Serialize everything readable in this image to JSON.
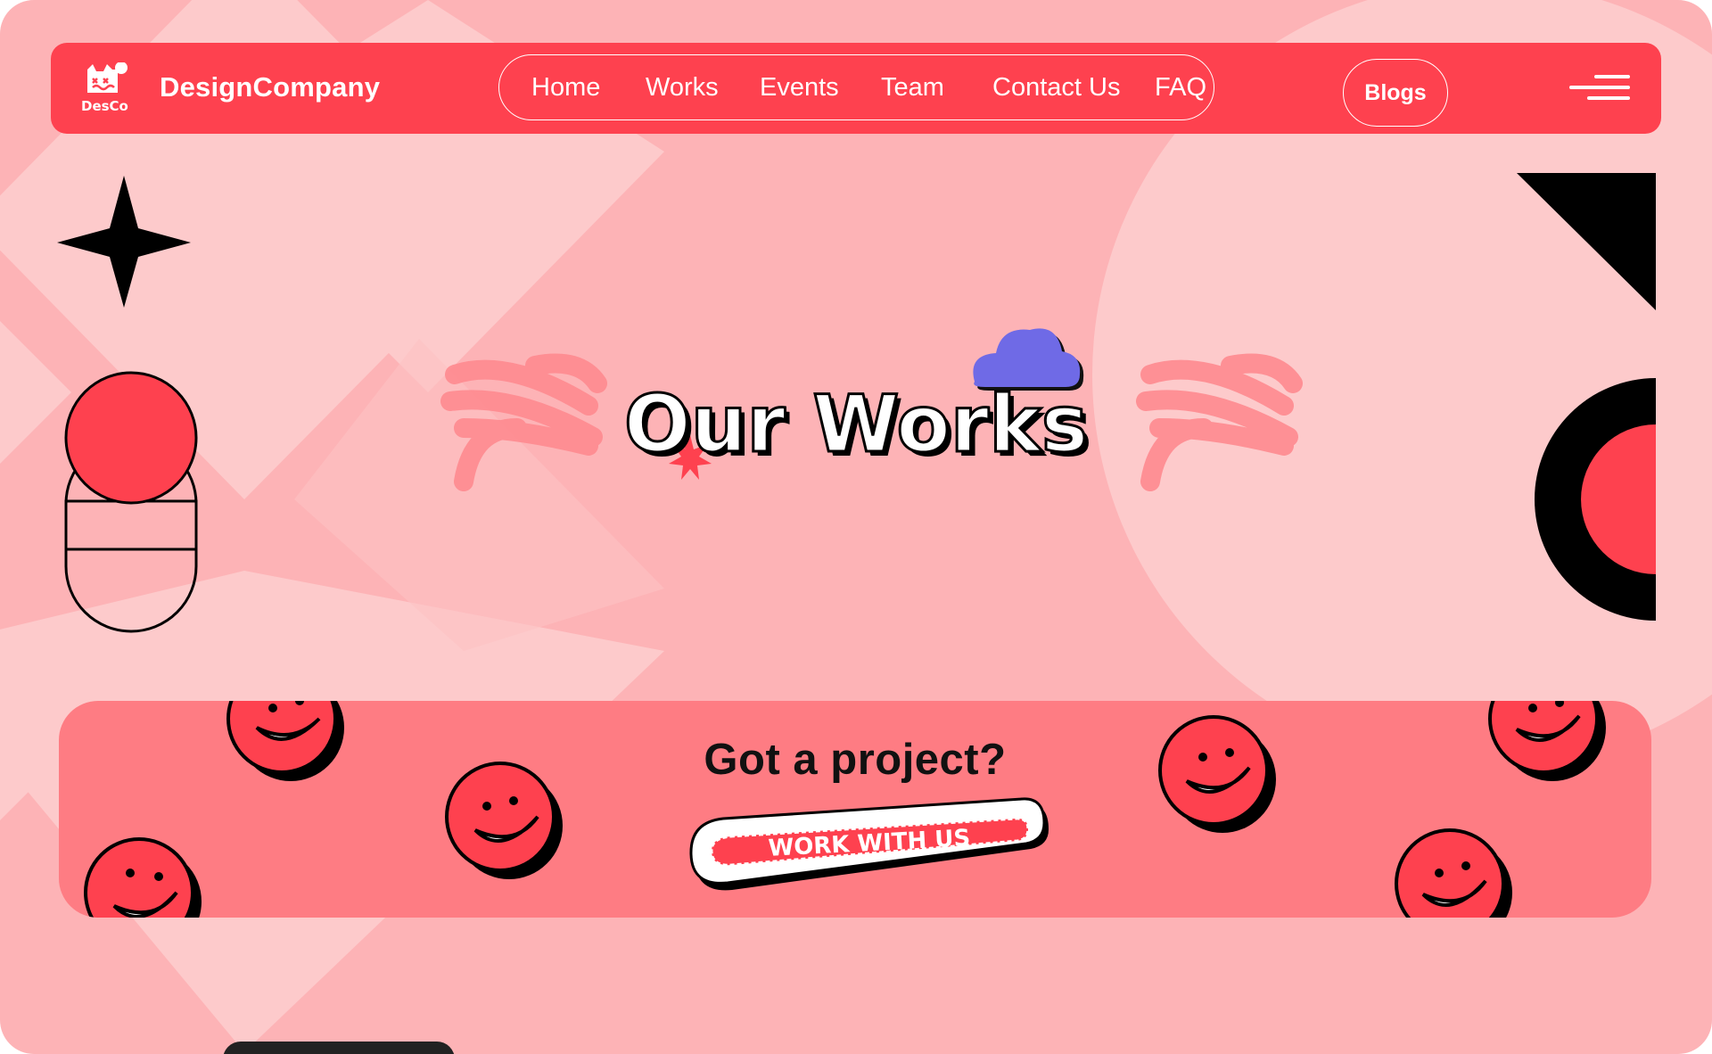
{
  "brand": {
    "logo_text": "DesCo",
    "name": "DesignCompany"
  },
  "nav": {
    "links": [
      "Home",
      "Works",
      "Events",
      "Team",
      "Contact Us",
      "FAQ"
    ],
    "blogs_label": "Blogs"
  },
  "hero": {
    "title": "Our Works"
  },
  "cta": {
    "heading": "Got a project?",
    "button_label": "WORK WITH US"
  },
  "icons": {
    "menu": "hamburger-menu-icon",
    "decor": [
      "four-point-star-icon",
      "circle-capsule-icon",
      "triangle-icon",
      "half-ring-icon",
      "cloud-icon",
      "starburst-icon",
      "scribble-icon",
      "smiley-face-icon"
    ]
  },
  "colors": {
    "primary": "#fe414f",
    "page_bg": "#fdb3b6",
    "cta_bg": "#fe7c83",
    "cloud": "#6f6ae6"
  }
}
